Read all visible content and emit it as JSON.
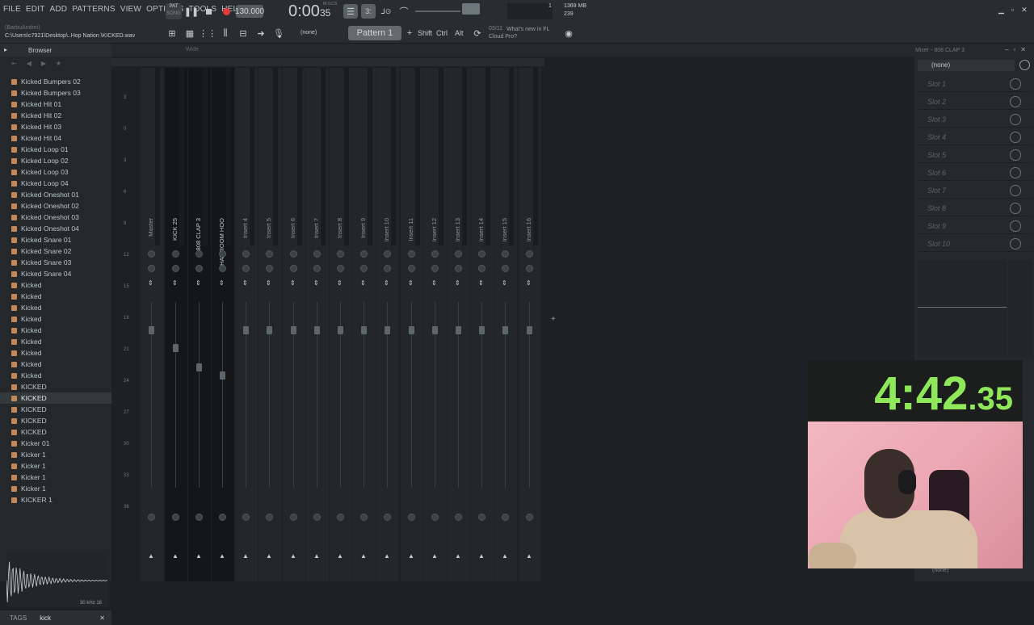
{
  "menu": [
    "FILE",
    "EDIT",
    "ADD",
    "PATTERNS",
    "VIEW",
    "OPTIONS",
    "TOOLS",
    "HELP"
  ],
  "transport": {
    "pat_label": "PAT",
    "song_label": "SONG",
    "tempo": "130.000",
    "time_main": "0:00",
    "time_sub": "35",
    "time_unit": "M:S:CS",
    "cpu_mb": "1369 MB",
    "cpu_val": "239",
    "counter": "1"
  },
  "toolbar": {
    "user": "(BarbuAndrei)",
    "file_path": "C:\\Users\\c7921\\Desktop\\..Hop Nation \\KICKED.wav",
    "none_select": "(none)",
    "pattern": "Pattern 1",
    "shift": "Shift",
    "ctrl": "Ctrl",
    "alt": "Alt",
    "news_index": "03/11",
    "news_text": "What's new in FL Cloud Pro?"
  },
  "browser": {
    "title": "Browser",
    "items": [
      "Kicked Bumpers 02",
      "Kicked Bumpers 03",
      "Kicked Hit 01",
      "Kicked Hit 02",
      "Kicked Hit 03",
      "Kicked Hit 04",
      "Kicked Loop 01",
      "Kicked Loop 02",
      "Kicked Loop 03",
      "Kicked Loop 04",
      "Kicked Oneshot 01",
      "Kicked Oneshot 02",
      "Kicked Oneshot 03",
      "Kicked Oneshot 04",
      "Kicked Snare 01",
      "Kicked Snare 02",
      "Kicked Snare 03",
      "Kicked Snare 04",
      "Kicked",
      "Kicked",
      "Kicked",
      "Kicked",
      "Kicked",
      "Kicked",
      "Kicked",
      "Kicked",
      "Kicked",
      "KICKED",
      "KICKED",
      "KICKED",
      "KICKED",
      "KICKED",
      "Kicker 01",
      "Kicker 1",
      "Kicker 1",
      "Kicker 1",
      "Kicker 1",
      "KICKER 1"
    ],
    "selected_index": 28,
    "sample_info": "30 kHz 16",
    "tags_label": "TAGS",
    "search_value": "kick"
  },
  "mixer": {
    "view_label": "Wide",
    "scale": [
      "3",
      "0",
      "3",
      "6",
      "9",
      "12",
      "15",
      "18",
      "21",
      "24",
      "27",
      "30",
      "33",
      "36"
    ],
    "tracks": [
      "Master",
      "KICK 25",
      "808 CLAP 3",
      "HAT ROOM HOO",
      "Insert 4",
      "Insert 5",
      "Insert 6",
      "Insert 7",
      "Insert 8",
      "Insert 9",
      "Insert 10",
      "Insert 11",
      "Insert 12",
      "Insert 13",
      "Insert 14",
      "Insert 15",
      "Insert 16"
    ],
    "header_numbers": [
      "C",
      "M",
      "1",
      "2",
      "3",
      "4",
      "5",
      "6",
      "7",
      "8",
      "9",
      "10",
      "11",
      "12",
      "13",
      "14",
      "15",
      "16"
    ],
    "selected_track": 2
  },
  "mixer_panel": {
    "title": "Mixer - 808 CLAP 3",
    "preset": "(none)",
    "slots": [
      "Slot 1",
      "Slot 2",
      "Slot 3",
      "Slot 4",
      "Slot 5",
      "Slot 6",
      "Slot 7",
      "Slot 8",
      "Slot 9",
      "Slot 10"
    ],
    "bottom_preset": "(none)"
  },
  "timer": {
    "main": "4:42",
    "fraction": ".35"
  },
  "colors": {
    "timer": "#8ee85a",
    "record": "#e03a3a",
    "file_icon": "#c4875a",
    "accent": "#d4a14a"
  }
}
